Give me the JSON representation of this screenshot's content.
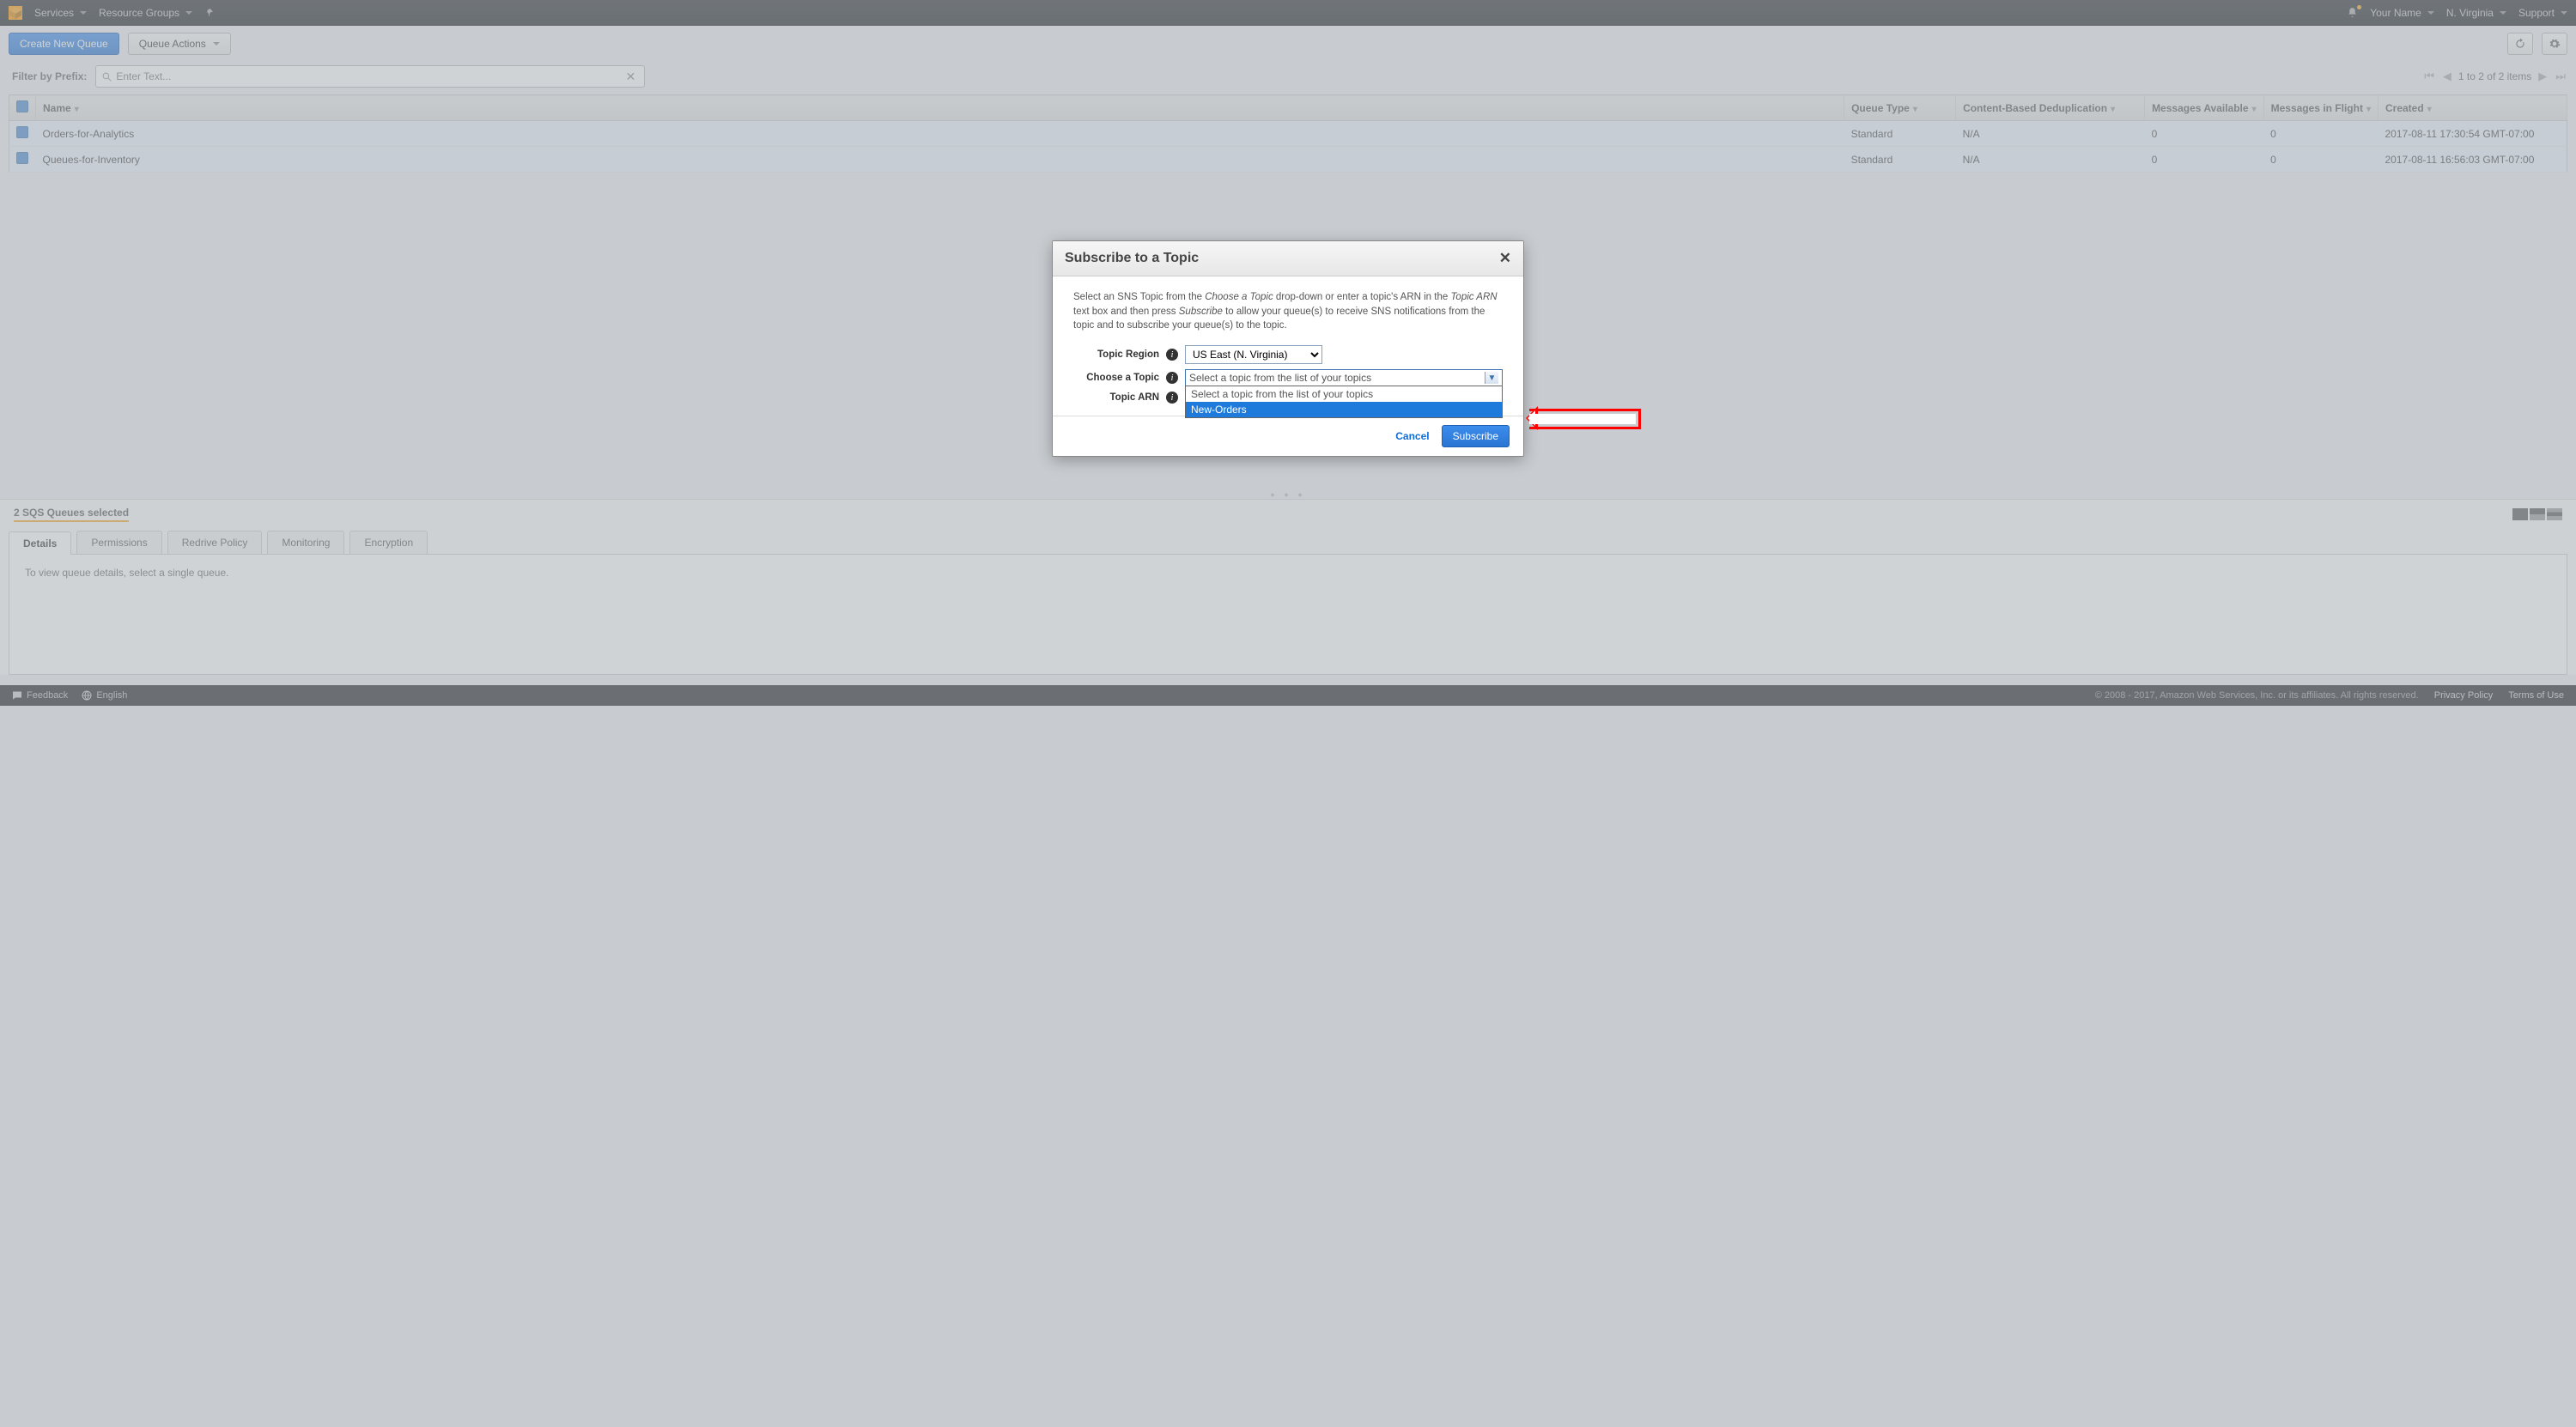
{
  "nav": {
    "services": "Services",
    "resource_groups": "Resource Groups",
    "user": "Your Name",
    "region": "N. Virginia",
    "support": "Support"
  },
  "toolbar": {
    "create": "Create New Queue",
    "actions": "Queue Actions"
  },
  "filter": {
    "label": "Filter by Prefix:",
    "placeholder": "Enter Text...",
    "pager": "1 to 2 of 2 items"
  },
  "columns": {
    "name": "Name",
    "queue_type": "Queue Type",
    "dedup": "Content-Based Deduplication",
    "msgs": "Messages Available",
    "inflight": "Messages in Flight",
    "created": "Created"
  },
  "rows": [
    {
      "name": "Orders-for-Analytics",
      "queue_type": "Standard",
      "dedup": "N/A",
      "msgs": "0",
      "inflight": "0",
      "created": "2017-08-11 17:30:54 GMT-07:00"
    },
    {
      "name": "Queues-for-Inventory",
      "queue_type": "Standard",
      "dedup": "N/A",
      "msgs": "0",
      "inflight": "0",
      "created": "2017-08-11 16:56:03 GMT-07:00"
    }
  ],
  "selection_summary": "2 SQS Queues selected",
  "tabs": {
    "details": "Details",
    "permissions": "Permissions",
    "redrive": "Redrive Policy",
    "monitoring": "Monitoring",
    "encryption": "Encryption"
  },
  "details_body": "To view queue details, select a single queue.",
  "footer": {
    "feedback": "Feedback",
    "language": "English",
    "copyright": "© 2008 - 2017, Amazon Web Services, Inc. or its affiliates. All rights reserved.",
    "privacy": "Privacy Policy",
    "terms": "Terms of Use"
  },
  "modal": {
    "title": "Subscribe to a Topic",
    "help_1a": "Select an SNS Topic from the ",
    "help_1b": "Choose a Topic",
    "help_1c": " drop-down or enter a topic's ARN in the ",
    "help_1d": "Topic ARN",
    "help_1e": " text box and then press ",
    "help_1f": "Subscribe",
    "help_1g": " to allow your queue(s) to receive SNS notifications from the topic and to subscribe your queue(s) to the topic.",
    "region_label": "Topic Region",
    "region_value": "US East (N. Virginia)",
    "choose_label": "Choose a Topic",
    "choose_value": "Select a topic from the list of your topics",
    "arn_label": "Topic ARN",
    "options": [
      "Select a topic from the list of your topics",
      "New-Orders"
    ],
    "cancel": "Cancel",
    "subscribe": "Subscribe"
  }
}
